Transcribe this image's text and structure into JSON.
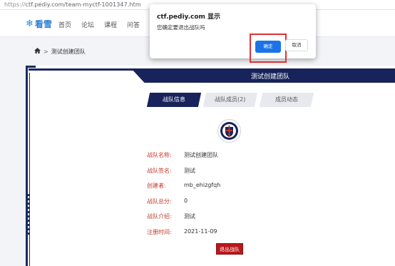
{
  "browser": {
    "url_scheme": "https://",
    "url_rest": "ctf.pediy.com/team-myctf-1001347.htm"
  },
  "header": {
    "logo_text": "看雪",
    "nav": [
      "首页",
      "论坛",
      "课程",
      "问答"
    ]
  },
  "breadcrumb": {
    "current": "测试创建团队"
  },
  "panel": {
    "title": "测试创建团队",
    "tabs": {
      "info": "战队信息",
      "members": "战队成员(2)",
      "activity": "成员动态"
    },
    "fields": [
      {
        "label": "战队名称:",
        "value": "测试创建团队"
      },
      {
        "label": "战队签名:",
        "value": "测试"
      },
      {
        "label": "创建者:",
        "value": "mb_ehizgfqh"
      },
      {
        "label": "战队总分:",
        "value": "0"
      },
      {
        "label": "战队介绍:",
        "value": "测试"
      },
      {
        "label": "注册时间:",
        "value": "2021-11-09"
      }
    ],
    "quit_label": "退出战队"
  },
  "dialog": {
    "title": "ctf.pediy.com 显示",
    "message": "您确定要退出战队吗",
    "ok_label": "确定",
    "cancel_label": "取消"
  },
  "colors": {
    "navy": "#17235a",
    "label_red": "#c0392b",
    "quit_red": "#b7191c",
    "ok_blue": "#1a73e8",
    "highlight_red": "#e03131"
  }
}
